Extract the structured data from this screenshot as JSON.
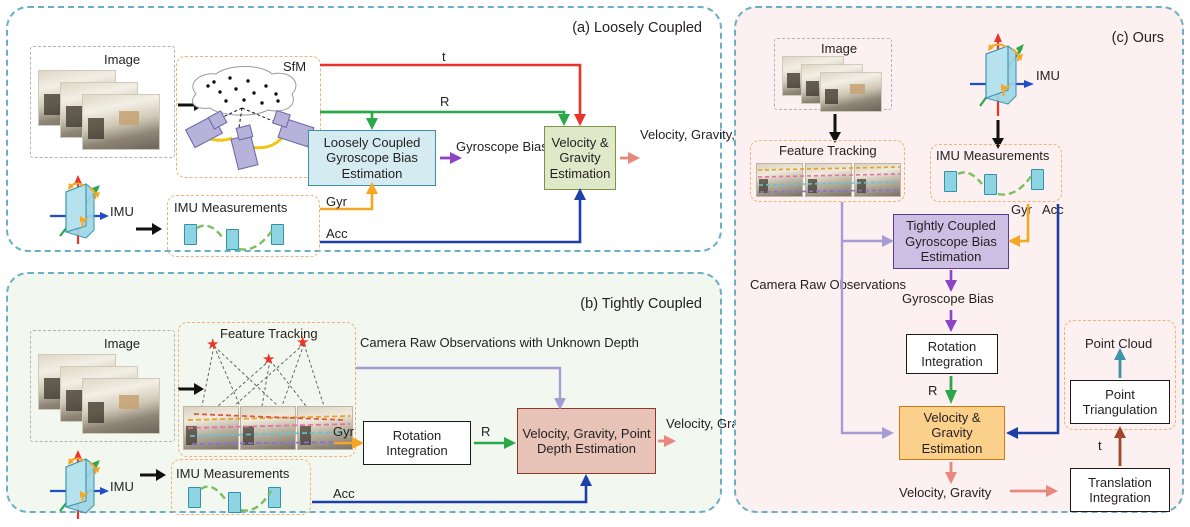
{
  "figure": {
    "type": "diagram",
    "description": "Three-panel comparison of visual-inertial initialization pipelines",
    "panels": [
      "a",
      "b",
      "c"
    ]
  },
  "colors": {
    "panel_border": "#6aafc4",
    "panel_a_bg": "#ffffff",
    "panel_b_bg": "#f2f8ef",
    "panel_c_bg": "#fdf0f0",
    "dashed_group_orange": "#f0b27a",
    "dashed_group_gray": "#b3b3b3",
    "arrow_t_red": "#e8352a",
    "arrow_R_green": "#2aa84a",
    "arrow_gyr_yellow": "#f5a623",
    "arrow_acc_blue": "#1f3fa8",
    "arrow_bias_purple": "#8e44c9",
    "arrow_output_salmon": "#e8877d",
    "arrow_raw_obs_lavender": "#a89bd4",
    "arrow_pointcloud_teal": "#3d93a8",
    "arrow_t_brown": "#a0482a",
    "box_loosely_coupled": "#d4ebf2",
    "box_velocity_gravity": "#dfe8c8",
    "box_velocity_gravity_point_depth": "#e8c4b8",
    "box_tightly_coupled": "#cdbfe3",
    "box_velocity_gravity_orange": "#fbd08a",
    "imu_body": "#9ed6e6"
  },
  "panel_a": {
    "title": "(a) Loosely Coupled",
    "image_group_label": "Image",
    "sfm_label": "SfM",
    "imu_label": "IMU",
    "imu_measurements_label": "IMU Measurements",
    "edge_t": "t",
    "edge_R": "R",
    "edge_gyr": "Gyr",
    "edge_acc": "Acc",
    "box_bias": "Loosely Coupled Gyroscope Bias Estimation",
    "mid_label": "Gyroscope Bias",
    "box_vg": "Velocity & Gravity Estimation",
    "output": "Velocity, Gravity, Scale, Point Cloud"
  },
  "panel_b": {
    "title": "(b) Tightly Coupled",
    "image_group_label": "Image",
    "feature_tracking_label": "Feature Tracking",
    "raw_obs_label": "Camera Raw Observations with Unknown Depth",
    "imu_label": "IMU",
    "imu_measurements_label": "IMU Measurements",
    "edge_gyr": "Gyr",
    "edge_acc": "Acc",
    "edge_R": "R",
    "box_rotation": "Rotation Integration",
    "box_vgpd": "Velocity, Gravity, Point Depth Estimation",
    "output": "Velocity, Gravity, Point Cloud"
  },
  "panel_c": {
    "title": "(c) Ours",
    "image_group_label": "Image",
    "feature_tracking_label": "Feature Tracking",
    "imu_label": "IMU",
    "imu_measurements_label": "IMU Measurements",
    "edge_gyr": "Gyr",
    "edge_acc": "Acc",
    "edge_R": "R",
    "edge_t": "t",
    "raw_obs_label": "Camera Raw Observations",
    "box_tc_bias": "Tightly Coupled Gyroscope Bias Estimation",
    "mid_bias_label": "Gyroscope Bias",
    "box_rotation": "Rotation Integration",
    "box_vg": "Velocity & Gravity Estimation",
    "output_vg": "Velocity, Gravity",
    "box_translation": "Translation Integration",
    "box_triangulation": "Point Triangulation",
    "point_cloud_label": "Point Cloud"
  }
}
